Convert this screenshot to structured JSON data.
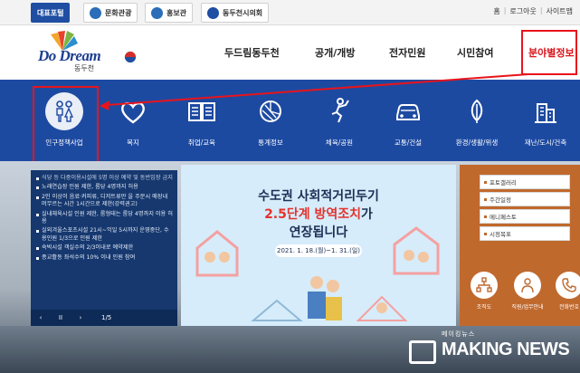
{
  "topbar": {
    "tabs": [
      {
        "label": "대표포털",
        "icon": "portal-tab"
      },
      {
        "label": "문화관광",
        "icon": "mountain-icon"
      },
      {
        "label": "홍보관",
        "icon": "pr-icon"
      },
      {
        "label": "동두천시의회",
        "icon": "council-seal-icon"
      }
    ],
    "links": [
      "홈",
      "로그아웃",
      "사이트맵"
    ]
  },
  "header": {
    "logo_text": "Do Dream",
    "logo_sub": "동두천",
    "nav": [
      "두드림동두천",
      "공개/개방",
      "전자민원",
      "시민참여",
      "분야별정보"
    ]
  },
  "categories": [
    {
      "label": "인구정책사업",
      "icon": "family-icon"
    },
    {
      "label": "복지",
      "icon": "heart-icon"
    },
    {
      "label": "취업/교육",
      "icon": "book-icon"
    },
    {
      "label": "통계정보",
      "icon": "pie-chart-icon"
    },
    {
      "label": "체육/공원",
      "icon": "sports-icon"
    },
    {
      "label": "교통/건설",
      "icon": "car-icon"
    },
    {
      "label": "환경/생활/위생",
      "icon": "leaf-icon"
    },
    {
      "label": "재난/도시/건축",
      "icon": "building-icon"
    }
  ],
  "news": {
    "items": [
      "식당 등 다중이용시설에 5명 이상 예약 및 동반입장 금지",
      "노래연습장 인원 제한, 룸당 4명까지 허용",
      "2인 이상이 음료·커피류, 디저트류만 을 주문시 매장내 머무르는 시간 1시간으로 제한(강력권고)",
      "실내체육시설 인원 제한, 룸형태는 룸당 4명까지 이용 허용",
      "실외겨울스포츠시설 21시~익일 5시까지 운영중단, 수용인원 1/3으로 인원 제한",
      "숙박시설 객실수의 2/3이내로 예약제한",
      "종교활동 좌석수의 10% 이내 인원 참여"
    ],
    "controls": {
      "prev": "‹",
      "pause": "II",
      "next": "›",
      "page": "1/5"
    }
  },
  "banner": {
    "line1": "수도권 사회적거리두기",
    "line2_accent": "2.5단계 방역조치",
    "line2_rest": "가",
    "line3": "연장됩니다",
    "date": "2021. 1. 18.(월)~1. 31.(일)"
  },
  "quick_menu": {
    "items": [
      "포토갤러리",
      "주간일정",
      "메니페스토",
      "시정목표"
    ],
    "tiles": [
      {
        "label": "조직도",
        "icon": "org-chart-icon"
      },
      {
        "label": "직원/업무안내",
        "icon": "staff-icon"
      },
      {
        "label": "전화번호",
        "icon": "phone-icon"
      }
    ]
  },
  "watermark": {
    "small": "메이킹뉴스",
    "big": "MAKING NEWS"
  },
  "colors": {
    "brand_blue": "#1d4aa1",
    "highlight_red": "#e8141b",
    "news_panel": "#16386f",
    "banner_bg": "#d6ecfa",
    "accent_orange": "#c0692d"
  }
}
